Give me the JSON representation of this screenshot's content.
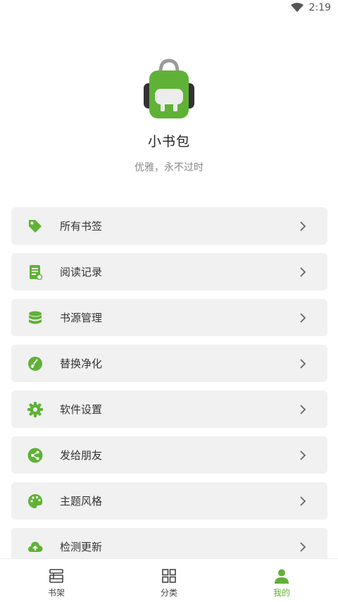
{
  "status_bar": {
    "time": "2:19",
    "icons": [
      "wifi-icon",
      "battery-icon"
    ]
  },
  "profile": {
    "name": "小书包",
    "slogan": "优雅，永不过时"
  },
  "menu": {
    "items": [
      {
        "label": "所有书签",
        "icon": "bookmark-tag-icon"
      },
      {
        "label": "阅读记录",
        "icon": "reading-history-icon"
      },
      {
        "label": "书源管理",
        "icon": "database-icon"
      },
      {
        "label": "替换净化",
        "icon": "clean-brush-icon"
      },
      {
        "label": "软件设置",
        "icon": "gear-icon"
      },
      {
        "label": "发给朋友",
        "icon": "share-icon"
      },
      {
        "label": "主题风格",
        "icon": "palette-icon"
      },
      {
        "label": "检测更新",
        "icon": "cloud-upload-icon"
      }
    ]
  },
  "bottom_nav": {
    "items": [
      {
        "label": "书架",
        "icon": "bookshelf-icon",
        "active": false
      },
      {
        "label": "分类",
        "icon": "grid-icon",
        "active": false
      },
      {
        "label": "我的",
        "icon": "person-icon",
        "active": true
      }
    ]
  },
  "colors": {
    "accent": "#5fb236",
    "item_bg": "#f1f1f1",
    "text": "#333333",
    "muted": "#888888"
  }
}
